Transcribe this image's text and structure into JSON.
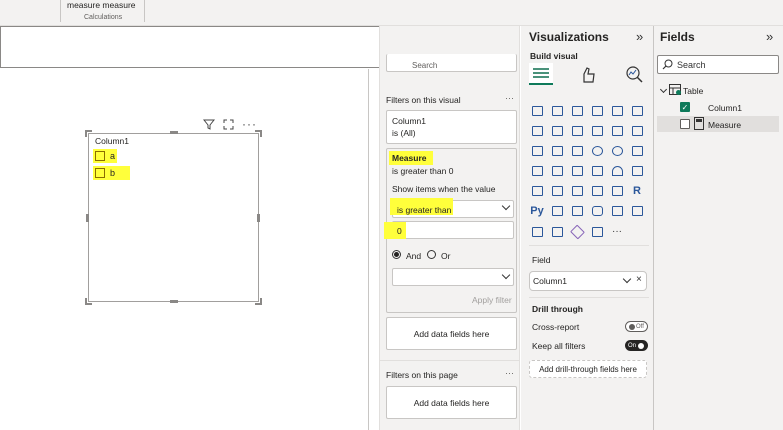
{
  "ribbon": {
    "measure_label": "measure measure",
    "group_label": "Calculations"
  },
  "visual": {
    "header": "Column1",
    "items": [
      {
        "label": "a"
      },
      {
        "label": "b"
      }
    ]
  },
  "filters": {
    "search_placeholder": "Search",
    "on_visual_title": "Filters on this visual",
    "card1": {
      "title": "Column1",
      "sub": "is (All)"
    },
    "card2": {
      "title": "Measure",
      "sub": "is greater than 0",
      "show_items": "Show items when the value",
      "condition": "is greater than",
      "value": "0",
      "and_label": "And",
      "or_label": "Or",
      "apply": "Apply filter"
    },
    "add_fields": "Add data fields here",
    "on_page_title": "Filters on this page",
    "add_fields_page": "Add data fields here"
  },
  "viz": {
    "title": "Visualizations",
    "build_visual": "Build visual",
    "field_label": "Field",
    "field_value": "Column1",
    "drill_title": "Drill through",
    "cross_report": "Cross-report",
    "cross_state": "Off",
    "keep_filters": "Keep all filters",
    "keep_state": "On",
    "add_drill": "Add drill-through fields here",
    "more": "···"
  },
  "fields": {
    "title": "Fields",
    "search_placeholder": "Search",
    "table_name": "Table",
    "items": [
      {
        "label": "Column1",
        "checked": true
      },
      {
        "label": "Measure",
        "checked": false
      }
    ]
  },
  "colors": {
    "highlight": "#ffff3b",
    "accent": "#2b579a",
    "pane_bg": "#f3f2f1",
    "check": "#0e7a5a"
  }
}
